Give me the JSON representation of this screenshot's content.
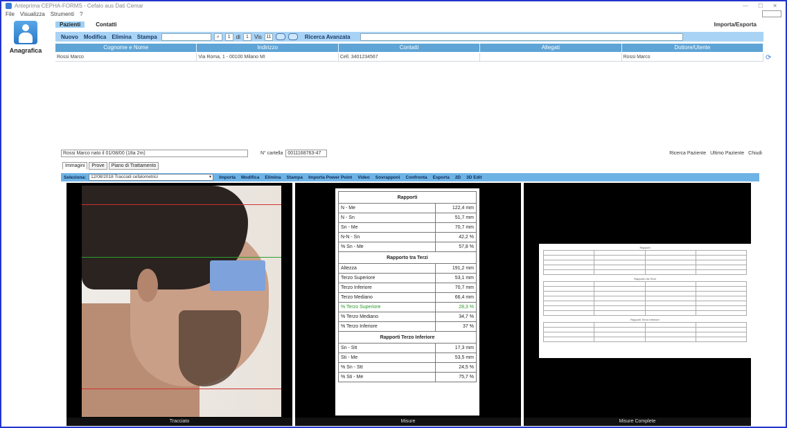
{
  "window": {
    "title": "Anteprima   CEPHA-FORMS  - Cefalo  aus  Dati  Cemar",
    "controls": [
      "—",
      "☐",
      "✕"
    ]
  },
  "menu": [
    "File",
    "Visualizza",
    "Strumenti",
    "?"
  ],
  "sidebar": {
    "label": "Anagrafica"
  },
  "tabs": [
    {
      "label": "Pazienti",
      "active": true
    },
    {
      "label": "Contatti",
      "active": false
    }
  ],
  "import_export": "Importa/Esporta",
  "toolbar": {
    "buttons": [
      "Nuovo",
      "Modifica",
      "Elimina",
      "Stampa"
    ],
    "page_value": "1",
    "page_of": "di",
    "page_total": "1",
    "page_size_label": "Vis",
    "page_size": "11",
    "filter_label": "Ricerca Avanzata"
  },
  "grid": {
    "columns": [
      "Cognome e Nome",
      "Indirizzo",
      "Contatti",
      "Allegati",
      "Dottore/Utente"
    ],
    "rows": [
      [
        "Rossi Marco",
        "Via Roma, 1 - 00100 Milano MI",
        "Cell. 3401234567",
        "",
        "Rossi Marco"
      ]
    ]
  },
  "patient": {
    "name_line": "Rossi Marco nato il 01/08/00 (18a 2m)",
    "cartella_label": "N° cartella",
    "cartella_value": "0011168763-47",
    "links": [
      "Ricerca Paziente",
      "Ultimo Paziente",
      "Chiudi"
    ]
  },
  "subtabs": [
    "Immagini",
    "Prove",
    "Piano di Trattamento"
  ],
  "image_toolbar": {
    "select_label": "Seleziona:",
    "select_value": "12/08/2018 Tracciati cefalometrici",
    "actions": [
      "Importa",
      "Modifica",
      "Elimina",
      "Stampa",
      "Importa Power Point",
      "Video",
      "Sovrapponi",
      "Confronta",
      "Esporta",
      "2D",
      "3D Edit"
    ]
  },
  "panels": [
    {
      "footer": "Tracciato"
    },
    {
      "footer": "Misure"
    },
    {
      "footer": "Misure Complete"
    }
  ],
  "analysis": {
    "sections": [
      {
        "title": "Rapporti",
        "rows": [
          {
            "label": "N - Me",
            "value": "122,4 mm",
            "green": false
          },
          {
            "label": "N - Sn",
            "value": "51,7 mm",
            "green": false
          },
          {
            "label": "Sn - Me",
            "value": "70,7 mm",
            "green": false
          },
          {
            "label": "N-N - Sn",
            "value": "42,2 %",
            "green": false
          },
          {
            "label": "% Sn - Me",
            "value": "57,8 %",
            "green": false
          }
        ]
      },
      {
        "title": "Rapporto tra Terzi",
        "rows": [
          {
            "label": "Altezza",
            "value": "191,2 mm",
            "green": false
          },
          {
            "label": "Terzo Superiore",
            "value": "53,1 mm",
            "green": false
          },
          {
            "label": "Terzo Inferiore",
            "value": "70,7 mm",
            "green": false
          },
          {
            "label": "Terzo Mediano",
            "value": "66,4 mm",
            "green": false
          },
          {
            "label": "% Terzo Superiore",
            "value": "28,3 %",
            "green": true
          },
          {
            "label": "% Terzo Mediano",
            "value": "34,7 %",
            "green": false
          },
          {
            "label": "% Terzo Inferiore",
            "value": "37 %",
            "green": false
          }
        ]
      },
      {
        "title": "Rapporti Terzo Inferiore",
        "rows": [
          {
            "label": "Sn - Stt",
            "value": "17,3 mm",
            "green": false
          },
          {
            "label": "Sti - Me",
            "value": "53,5 mm",
            "green": false
          },
          {
            "label": "% Sn - Stt",
            "value": "24,5 %",
            "green": false
          },
          {
            "label": "% Sti - Me",
            "value": "75,7 %",
            "green": false
          }
        ]
      }
    ]
  },
  "colors": {
    "frame": "#2233cc",
    "toolbar": "#a9d3f5",
    "grid_header": "#5ea4d6",
    "image_toolbar": "#6eb3e6",
    "line_red": "#d03030",
    "line_green": "#2ca02c"
  }
}
